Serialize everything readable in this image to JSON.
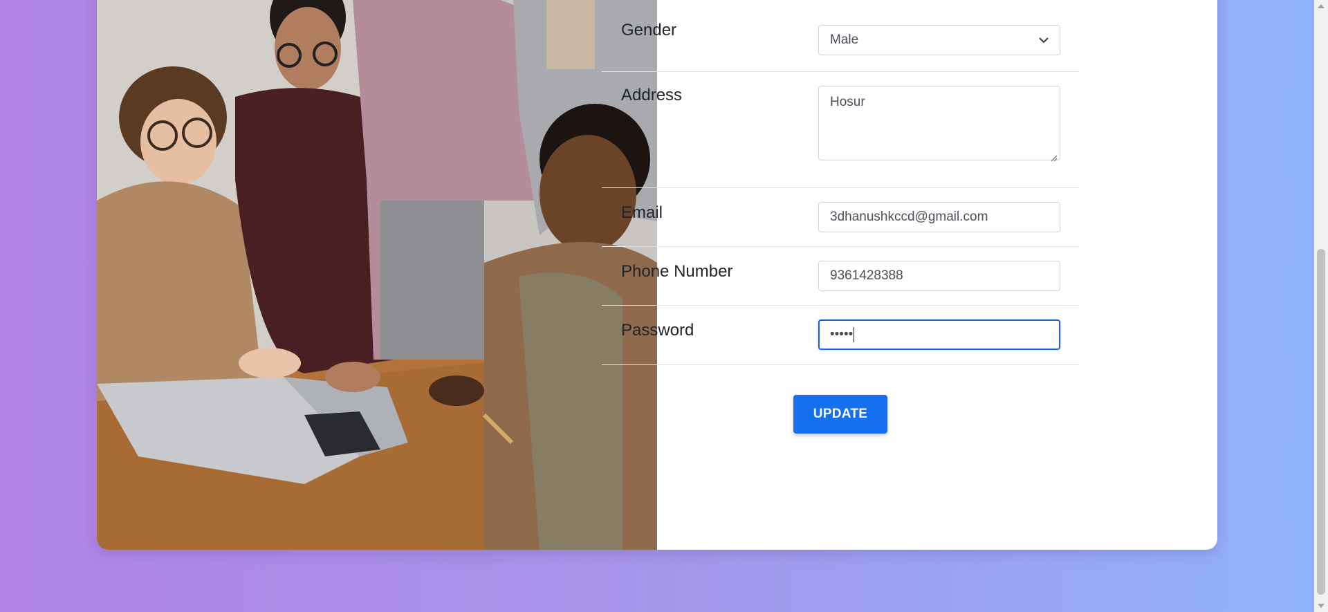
{
  "form": {
    "gender": {
      "label": "Gender",
      "value": "Male"
    },
    "address": {
      "label": "Address",
      "value": "Hosur"
    },
    "email": {
      "label": "Email",
      "value": "3dhanushkccd@gmail.com"
    },
    "phone": {
      "label": "Phone Number",
      "value": "9361428388"
    },
    "password": {
      "label": "Password",
      "value": "•••••"
    }
  },
  "actions": {
    "update_label": "UPDATE"
  },
  "icons": {
    "select_arrow": "chevron-down-icon",
    "textarea_grip": "resize-grip-icon"
  },
  "colors": {
    "primary": "#1570ef",
    "focus_border": "#1a62d8",
    "background_left": "#b284e6",
    "background_right": "#8fb3fb"
  }
}
